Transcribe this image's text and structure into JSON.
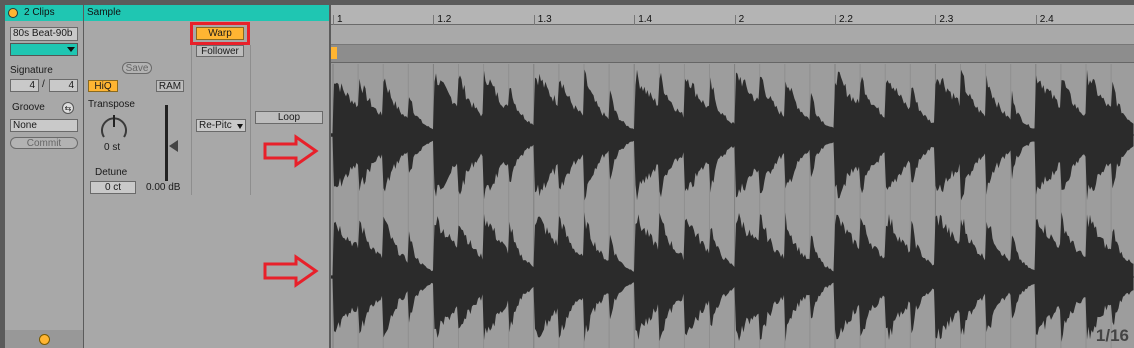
{
  "clip": {
    "header_title": "2 Clips",
    "clip_name": "80s Beat-90b",
    "signature_label": "Signature",
    "signature_numerator": "4",
    "signature_slash": "/",
    "signature_denominator": "4",
    "groove_label": "Groove",
    "groove_value": "None",
    "commit_label": "Commit",
    "color_hex": "#1fc6b2"
  },
  "sample": {
    "header_title": "Sample",
    "save_label": "Save",
    "hiq_label": "HiQ",
    "ram_label": "RAM",
    "transpose_label": "Transpose",
    "transpose_value": "0 st",
    "detune_label": "Detune",
    "detune_value": "0 ct",
    "gain_value": "0.00 dB",
    "warp_label": "Warp",
    "follower_label": "Follower",
    "warp_mode_value": "Re-Pitc",
    "loop_label": "Loop"
  },
  "timeline": {
    "markers": [
      "1",
      "1.2",
      "1.3",
      "1.4",
      "2",
      "2.2",
      "2.3",
      "2.4"
    ],
    "zoom_label": "1/16"
  },
  "colors": {
    "accent_orange": "#ffb532",
    "highlight_red": "#e8202a",
    "waveform": "#2b2b2b"
  }
}
